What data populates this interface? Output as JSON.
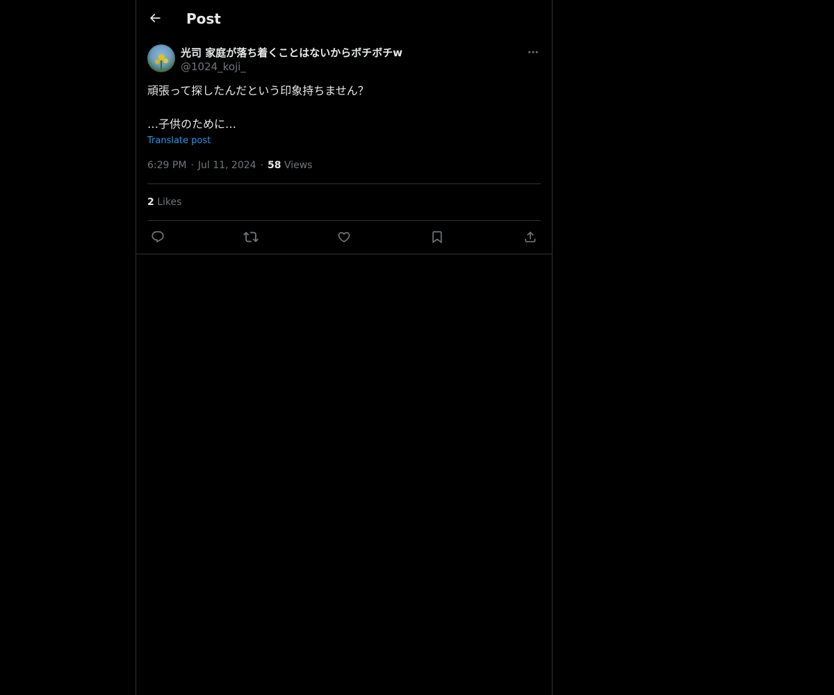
{
  "header": {
    "title": "Post",
    "back_icon": "arrow-left-icon"
  },
  "post": {
    "author": {
      "display_name": "光司 家庭が落ち着くことはないからボチボチw",
      "handle": "@1024_koji_",
      "avatar": "avatar-flowers-sky"
    },
    "more_icon": "ellipsis-icon",
    "text_lines": [
      "頑張って探したんだという印象持ちません？",
      "",
      "…子供のために…"
    ],
    "translate_label": "Translate post",
    "time": "6:29 PM",
    "date": "Jul 11, 2024",
    "separator": "·",
    "views_count": "58",
    "views_label": "Views",
    "likes_count": "2",
    "likes_label": "Likes"
  },
  "actions": {
    "reply_icon": "reply-icon",
    "repost_icon": "repost-icon",
    "like_icon": "heart-icon",
    "bookmark_icon": "bookmark-icon",
    "share_icon": "share-icon"
  },
  "colors": {
    "background": "#000000",
    "text_primary": "#e7e9ea",
    "text_secondary": "#71767b",
    "link": "#1d9bf0",
    "border": "#2f3336"
  }
}
